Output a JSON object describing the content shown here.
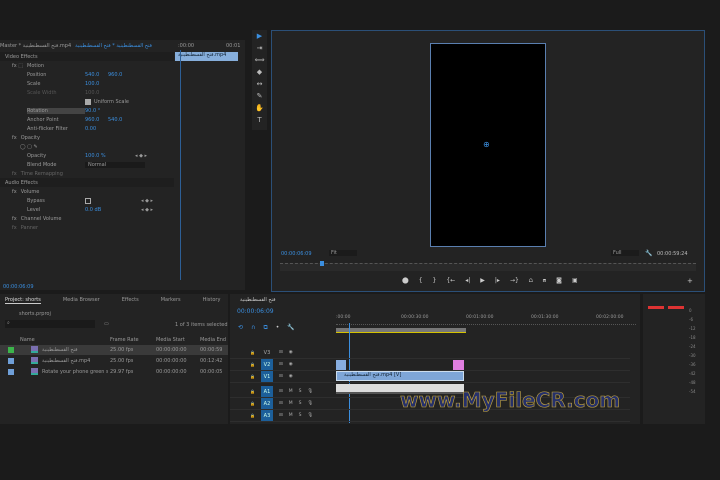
{
  "effect_controls": {
    "tab": "Master * فتح القسطنطينية.mp4",
    "clip": "فتح القسطنطينية * فتح القسطنطينية",
    "time_start": ":00:00",
    "time_end": "00:01",
    "mini_clip": "فتح القسطنطينية.mp4",
    "video_effects": "Video Effects",
    "motion": "Motion",
    "position": "Position",
    "pos_x": "540.0",
    "pos_y": "960.0",
    "scale": "Scale",
    "scale_v": "100.0",
    "scale_width": "Scale Width",
    "scale_width_v": "100.0",
    "uniform_scale": "Uniform Scale",
    "rotation": "Rotation",
    "rotation_v": "90.0 °",
    "anchor": "Anchor Point",
    "anchor_x": "960.0",
    "anchor_y": "540.0",
    "antiflicker": "Anti-flicker Filter",
    "antiflicker_v": "0.00",
    "opacity": "Opacity",
    "opacity_label": "Opacity",
    "opacity_v": "100.0 %",
    "blend": "Blend Mode",
    "blend_v": "Normal",
    "time_remap": "Time Remapping",
    "audio_effects": "Audio Effects",
    "volume": "Volume",
    "bypass": "Bypass",
    "level": "Level",
    "level_v": "0.0 dB",
    "channel_volume": "Channel Volume",
    "panner": "Panner",
    "timecode": "00:00:06:09"
  },
  "program": {
    "timecode": "00:00:06:09",
    "fit": "Fit",
    "quality": "Full",
    "duration": "00:00:59:24"
  },
  "project": {
    "tabs": [
      "Project: shorts",
      "Media Browser",
      "Effects",
      "Markers",
      "History"
    ],
    "file": "shorts.prproj",
    "selected": "1 of 3 items selected",
    "columns": [
      "Name",
      "Frame Rate",
      "Media Start",
      "Media End"
    ],
    "rows": [
      {
        "name": "فتح القسطنطينية",
        "fps": "25.00 fps",
        "start": "00:00:00:00",
        "end": "00:00:59",
        "color": "#3cb44b"
      },
      {
        "name": "فتح القسطنطينية.mp4",
        "fps": "25.00 fps",
        "start": "00:00:00:00",
        "end": "00:12:42",
        "color": "#6f9fd8"
      },
      {
        "name": "Rotate your phone green sc",
        "fps": "29.97 fps",
        "start": "00:00:00:00",
        "end": "00:00:05",
        "color": "#6f9fd8"
      }
    ]
  },
  "timeline": {
    "sequence": "فتح القسطنطينية",
    "timecode": "00:00:06:09",
    "ruler": [
      ":00:00",
      "00:00:30:00",
      "00:01:00:00",
      "00:01:30:00",
      "00:02:00:00"
    ],
    "tracks": [
      "V3",
      "V2",
      "V1",
      "A1",
      "A2",
      "A3"
    ],
    "clip": "فتح القسطنطينية.mp4 [V]"
  },
  "watermark": "www.MyFileCR.com",
  "meter": [
    "0",
    "-6",
    "-12",
    "-18",
    "-24",
    "-30",
    "-36",
    "-42",
    "-48",
    "-54"
  ]
}
